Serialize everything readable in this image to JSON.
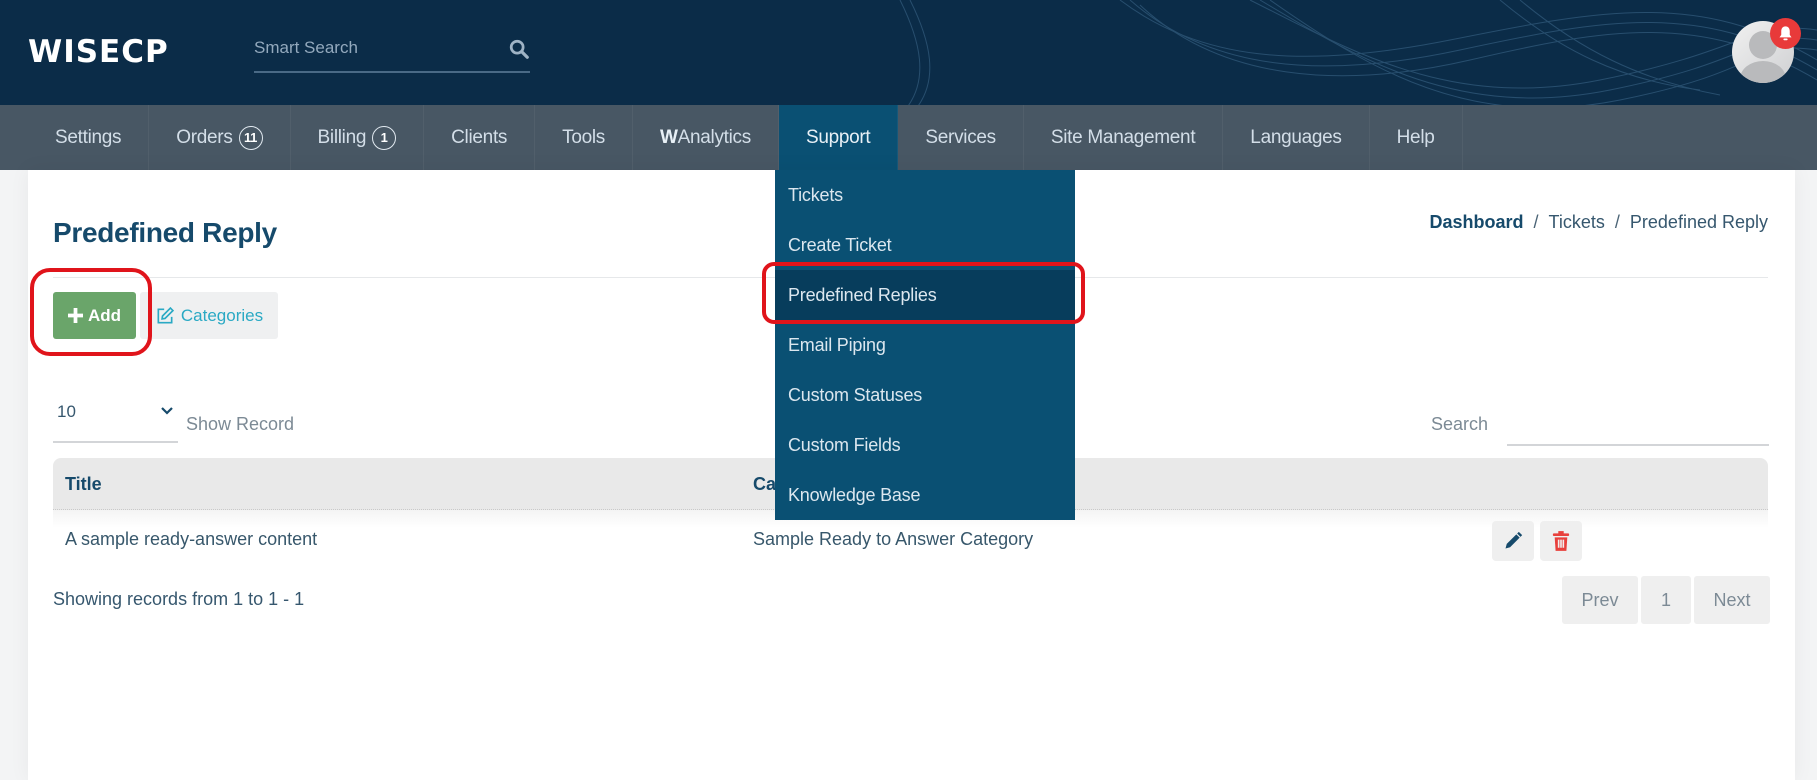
{
  "header": {
    "logo_text": "WISECP",
    "search_placeholder": "Smart Search"
  },
  "nav": {
    "items": [
      {
        "label": "Settings"
      },
      {
        "label": "Orders",
        "badge": "11"
      },
      {
        "label": "Billing",
        "badge": "1"
      },
      {
        "label": "Clients"
      },
      {
        "label": "Tools"
      },
      {
        "label_bold": "W",
        "label": "Analytics"
      },
      {
        "label": "Support",
        "active": true
      },
      {
        "label": "Services"
      },
      {
        "label": "Site Management"
      },
      {
        "label": "Languages"
      },
      {
        "label": "Help"
      }
    ]
  },
  "support_menu": {
    "items": [
      {
        "label": "Tickets"
      },
      {
        "label": "Create Ticket"
      },
      {
        "label": "Predefined Replies",
        "active": true
      },
      {
        "label": "Email Piping"
      },
      {
        "label": "Custom Statuses"
      },
      {
        "label": "Custom Fields"
      },
      {
        "label": "Knowledge Base"
      }
    ]
  },
  "page": {
    "title": "Predefined Reply",
    "breadcrumb": [
      "Dashboard",
      "Tickets",
      "Predefined Reply"
    ],
    "breadcrumb_separator": "/",
    "add_label": "Add",
    "categories_label": "Categories"
  },
  "table_controls": {
    "page_size": "10",
    "show_record_label": "Show Record",
    "search_label": "Search",
    "search_value": ""
  },
  "table": {
    "columns": [
      "Title",
      "Category"
    ],
    "rows": [
      {
        "title": "A sample ready-answer content",
        "category": "Sample Ready to Answer Category"
      }
    ]
  },
  "footer": {
    "showing_text": "Showing records from 1 to 1 - 1",
    "prev_label": "Prev",
    "current_page": "1",
    "next_label": "Next"
  },
  "colors": {
    "header_bg": "#0b2c48",
    "active_nav": "#0a5073",
    "add_button": "#6aa56a",
    "categories_text": "#2aa9c4",
    "delete_icon": "#e8403c",
    "edit_icon": "#164a6b",
    "annotation": "#e0141b"
  }
}
